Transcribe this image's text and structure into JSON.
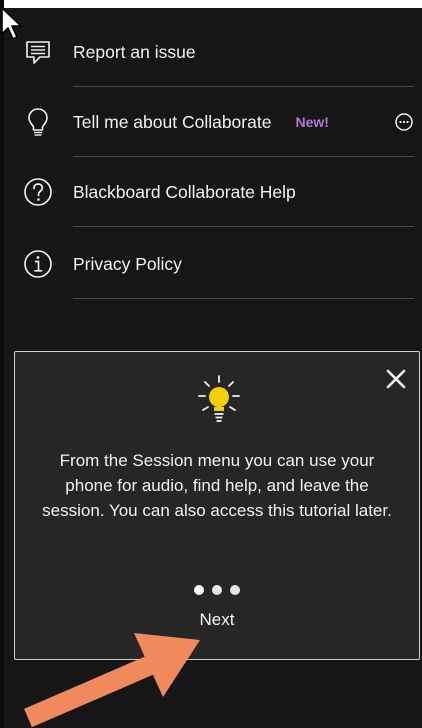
{
  "menu": {
    "items": [
      {
        "label": "Report an issue",
        "icon": "report-icon"
      },
      {
        "label": "Tell me about Collaborate",
        "icon": "lightbulb-icon",
        "badge": "New!",
        "more_icon": "more-options-icon"
      },
      {
        "label": "Blackboard Collaborate Help",
        "icon": "help-icon"
      },
      {
        "label": "Privacy Policy",
        "icon": "info-icon"
      }
    ]
  },
  "tutorial": {
    "icon": "lightbulb-icon",
    "text": "From the Session menu you can use your phone for audio, find help, and leave the session. You can also access this tutorial later.",
    "next_label": "Next",
    "close_icon": "close-icon",
    "step_count": 3,
    "badge_color": "#b576d6",
    "bulb_color": "#f5d000"
  },
  "annotation": {
    "arrow_color": "#f08a5d"
  }
}
